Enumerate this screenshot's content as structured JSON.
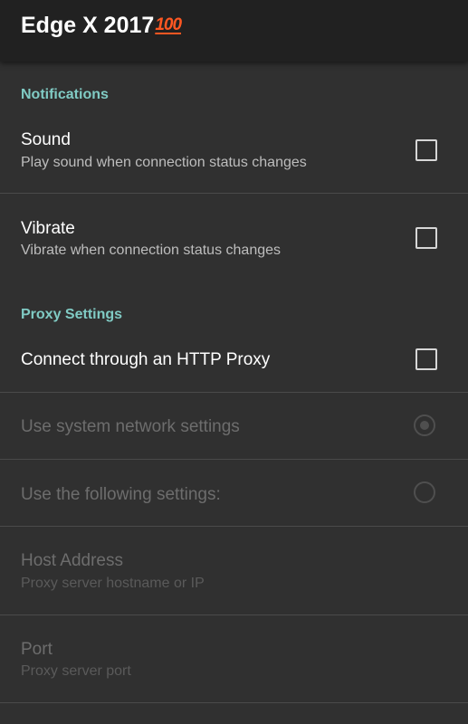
{
  "appbar": {
    "title": "Edge X 2017",
    "emoji": "100"
  },
  "sections": {
    "notifications": "Notifications",
    "proxy": "Proxy Settings"
  },
  "prefs": {
    "sound": {
      "title": "Sound",
      "summary": "Play sound when connection status changes",
      "checked": false
    },
    "vibrate": {
      "title": "Vibrate",
      "summary": "Vibrate when connection status changes",
      "checked": false
    },
    "http_proxy": {
      "title": "Connect through an HTTP Proxy",
      "checked": false
    },
    "system_network": {
      "title": "Use system network settings",
      "selected": true,
      "enabled": false
    },
    "following_settings": {
      "title": "Use the following settings:",
      "selected": false,
      "enabled": false
    },
    "host": {
      "title": "Host Address",
      "summary": "Proxy server hostname or IP",
      "enabled": false
    },
    "port": {
      "title": "Port",
      "summary": "Proxy server port",
      "enabled": false
    }
  },
  "colors": {
    "background": "#303030",
    "appbar": "#212121",
    "accent": "#80cbc4",
    "divider": "#4a4a4a"
  }
}
